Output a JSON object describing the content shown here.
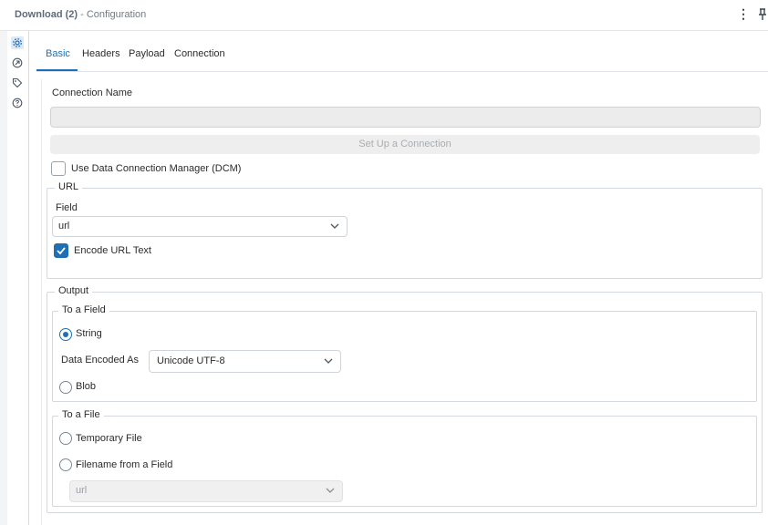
{
  "window": {
    "title_app": "Download (2)",
    "title_sub": " - Configuration",
    "menu_glyph": "⋮"
  },
  "side_icons": [
    {
      "icon": "gear-icon"
    },
    {
      "icon": "arrow-circle-icon"
    },
    {
      "icon": "tag-icon"
    },
    {
      "icon": "help-icon"
    }
  ],
  "tabs": [
    {
      "label": "Basic",
      "active": true
    },
    {
      "label": "Headers"
    },
    {
      "label": "Payload"
    },
    {
      "label": "Connection"
    }
  ],
  "connection": {
    "name_label": "Connection Name",
    "name_value": "",
    "setup_button": "Set Up a Connection",
    "dcm_label": "Use Data Connection Manager (DCM)",
    "dcm_checked": false
  },
  "url": {
    "legend": "URL",
    "field_label": "Field",
    "field_value": "url",
    "encode_label": "Encode URL Text",
    "encode_checked": true
  },
  "output": {
    "legend": "Output",
    "to_field": {
      "legend": "To a Field",
      "string_label": "String",
      "string_selected": true,
      "encoded_label": "Data Encoded As",
      "encoded_value": "Unicode UTF-8",
      "blob_label": "Blob",
      "blob_selected": false
    },
    "to_file": {
      "legend": "To a File",
      "temp_label": "Temporary File",
      "temp_selected": false,
      "filename_label": "Filename from a Field",
      "filename_selected": false,
      "filename_value": "url"
    }
  },
  "colors": {
    "accent": "#1f6fb5",
    "disabled_bg": "#ececec",
    "border": "#d3d8de"
  }
}
